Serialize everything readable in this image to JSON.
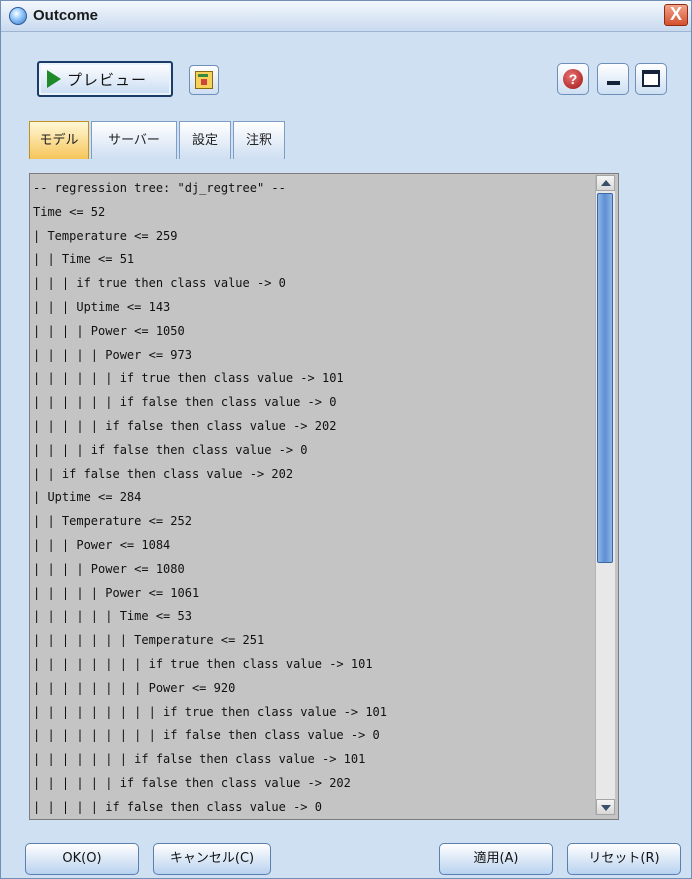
{
  "window": {
    "title": "Outcome",
    "close_label": "X"
  },
  "toolbar": {
    "preview_label": "プレビュー",
    "help_label": "?"
  },
  "tabs": [
    {
      "label": "モデル"
    },
    {
      "label": "サーバー"
    },
    {
      "label": "設定"
    },
    {
      "label": "注釈"
    }
  ],
  "output": {
    "lines": [
      "-- regression tree: \"dj_regtree\" --",
      "Time <= 52",
      "| Temperature <= 259",
      "| | Time <= 51",
      "| | | if true then class value -> 0",
      "| | | Uptime <= 143",
      "| | | | Power <= 1050",
      "| | | | | Power <= 973",
      "| | | | | | if true then class value -> 101",
      "| | | | | | if false then class value -> 0",
      "| | | | | if false then class value -> 202",
      "| | | | if false then class value -> 0",
      "| | if false then class value -> 202",
      "| Uptime <= 284",
      "| | Temperature <= 252",
      "| | | Power <= 1084",
      "| | | | Power <= 1080",
      "| | | | | Power <= 1061",
      "| | | | | | Time <= 53",
      "| | | | | | | Temperature <= 251",
      "| | | | | | | | if true then class value -> 101",
      "| | | | | | | | Power <= 920",
      "| | | | | | | | | if true then class value -> 101",
      "| | | | | | | | | if false then class value -> 0",
      "| | | | | | | if false then class value -> 101",
      "| | | | | | if false then class value -> 202",
      "| | | | | if false then class value -> 0"
    ]
  },
  "footer": {
    "ok_label": "OK(O)",
    "cancel_label": "キャンセル(C)",
    "apply_label": "適用(A)",
    "reset_label": "リセット(R)"
  }
}
